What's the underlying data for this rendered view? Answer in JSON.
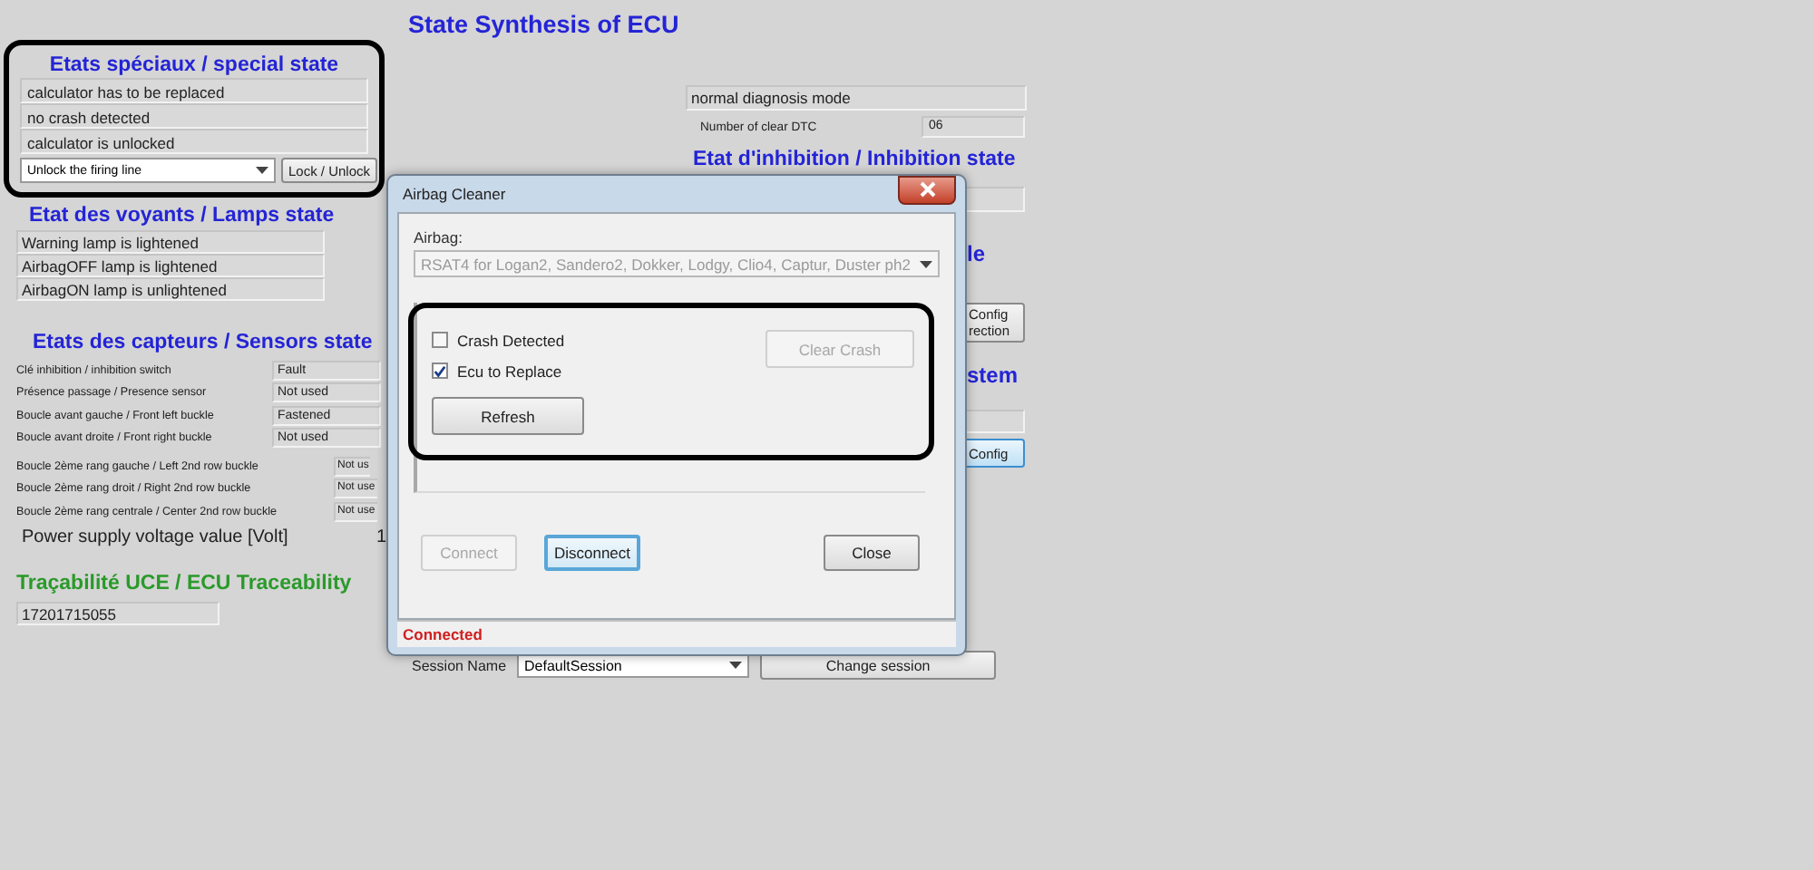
{
  "window_title": "State Synthesis of ECU",
  "special_state": {
    "heading": "Etats spéciaux / special state",
    "highlighted": true,
    "fields": [
      "calculator has to be replaced",
      "no crash detected",
      "calculator is unlocked"
    ],
    "firing_line_select": "Unlock the firing line",
    "lock_button": "Lock / Unlock"
  },
  "lamps_state": {
    "heading": "Etat des voyants / Lamps state",
    "fields": [
      "Warning lamp is lightened",
      "AirbagOFF lamp is lightened",
      "AirbagON lamp is unlightened"
    ]
  },
  "sensors_state": {
    "heading": "Etats des capteurs / Sensors state",
    "front_rows": [
      {
        "label": "Clé inhibition / inhibition switch",
        "value": "Fault"
      },
      {
        "label": "Présence passage / Presence sensor",
        "value": "Not used"
      },
      {
        "label": "Boucle avant gauche / Front left buckle",
        "value": "Fastened"
      },
      {
        "label": "Boucle avant droite / Front right buckle",
        "value": "Not used"
      }
    ],
    "second_row_rows": [
      {
        "label": "Boucle 2ème rang gauche / Left 2nd row buckle",
        "value": "Not us"
      },
      {
        "label": "Boucle 2ème rang droit / Right 2nd row buckle",
        "value": "Not use"
      },
      {
        "label": "Boucle 2ème rang centrale / Center 2nd row buckle",
        "value": "Not use"
      }
    ],
    "power_supply": {
      "label": "Power supply voltage value [Volt]",
      "value": "1"
    }
  },
  "traceability": {
    "heading": "Traçabilité UCE / ECU Traceability",
    "value": "17201715055"
  },
  "diagnosis": {
    "mode": "normal diagnosis mode",
    "clear_dtc_label": "Number of clear DTC",
    "clear_dtc_value": "06"
  },
  "inhibition_state": {
    "heading": "Etat d'inhibition / Inhibition state"
  },
  "right_fragments": {
    "heading_1": "le",
    "config_button_1": "Config rection",
    "heading_2": "stem",
    "config_button_2": "Config"
  },
  "session": {
    "label": "Session Name",
    "value": "DefaultSession",
    "button": "Change session"
  },
  "dialog": {
    "title": "Airbag Cleaner",
    "airbag_label": "Airbag:",
    "airbag_select": {
      "value": "RSAT4 for Logan2, Sandero2, Dokker, Lodgy, Clio4, Captur, Duster ph2",
      "disabled": true
    },
    "group_highlighted": true,
    "checkboxes": [
      {
        "label": "Crash Detected",
        "checked": false
      },
      {
        "label": "Ecu to Replace",
        "checked": true
      }
    ],
    "clear_crash": {
      "label": "Clear Crash",
      "disabled": true
    },
    "refresh": {
      "label": "Refresh",
      "disabled": false
    },
    "buttons": [
      {
        "label": "Connect",
        "disabled": true,
        "focused": false
      },
      {
        "label": "Disconnect",
        "disabled": false,
        "focused": true
      },
      {
        "label": "Close",
        "disabled": false,
        "focused": false
      }
    ],
    "status": "Connected"
  }
}
